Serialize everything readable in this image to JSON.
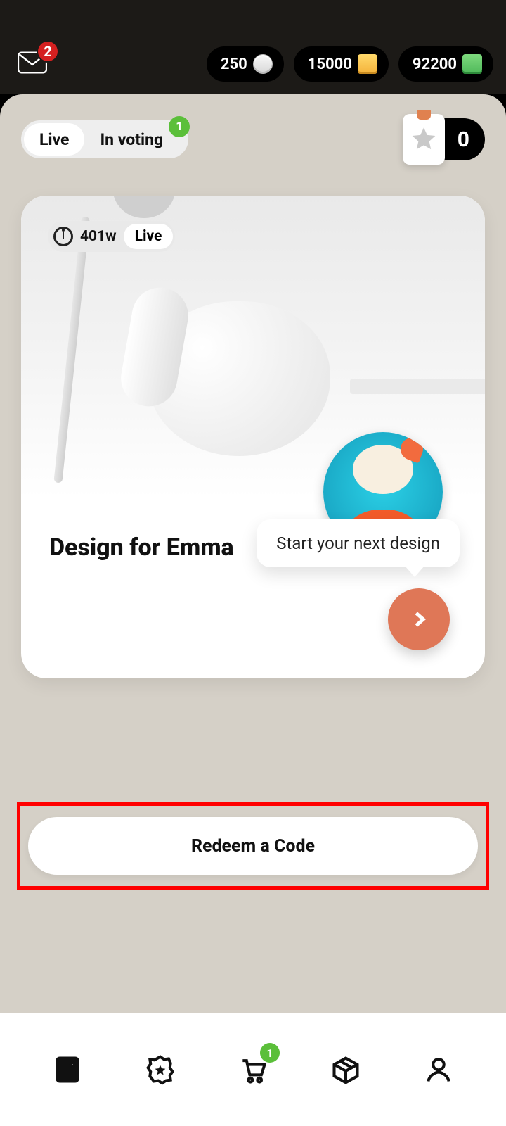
{
  "header": {
    "mail_badge": "2",
    "currencies": [
      {
        "value": "250",
        "icon": "coin"
      },
      {
        "value": "15000",
        "icon": "gold"
      },
      {
        "value": "92200",
        "icon": "cash"
      }
    ]
  },
  "tabs": {
    "live_label": "Live",
    "voting_label": "In voting",
    "voting_badge": "1"
  },
  "star_counter": "0",
  "card": {
    "time_value": "401w",
    "status_label": "Live",
    "title": "Design for Emma",
    "tooltip": "Start your next design"
  },
  "redeem_label": "Redeem a Code",
  "nav": {
    "cart_badge": "1"
  }
}
